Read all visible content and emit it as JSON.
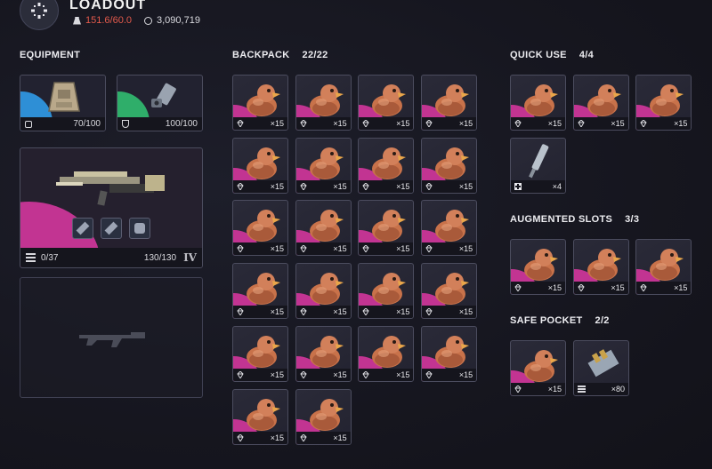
{
  "header": {
    "title": "LOADOUT",
    "weight": "151.6/60.0",
    "currency": "3,090,719"
  },
  "colors": {
    "epic": "#c23492",
    "legendary_blue": "#2e8fd6",
    "uncommon_green": "#2fae6a",
    "weight_over": "#e45a4c"
  },
  "equipment": {
    "label": "EQUIPMENT",
    "augment": {
      "icon": "chest-rig-icon",
      "value": "70/100"
    },
    "shield": {
      "icon": "shield-device-icon",
      "value": "100/100"
    },
    "weapon": {
      "ammo": "0/37",
      "durability": "130/130",
      "tier": "IV"
    }
  },
  "backpack": {
    "label": "BACKPACK",
    "count": "22/22",
    "items": [
      {
        "qty": "×15"
      },
      {
        "qty": "×15"
      },
      {
        "qty": "×15"
      },
      {
        "qty": "×15"
      },
      {
        "qty": "×15"
      },
      {
        "qty": "×15"
      },
      {
        "qty": "×15"
      },
      {
        "qty": "×15"
      },
      {
        "qty": "×15"
      },
      {
        "qty": "×15"
      },
      {
        "qty": "×15"
      },
      {
        "qty": "×15"
      },
      {
        "qty": "×15"
      },
      {
        "qty": "×15"
      },
      {
        "qty": "×15"
      },
      {
        "qty": "×15"
      },
      {
        "qty": "×15"
      },
      {
        "qty": "×15"
      },
      {
        "qty": "×15"
      },
      {
        "qty": "×15"
      },
      {
        "qty": "×15"
      },
      {
        "qty": "×15"
      }
    ]
  },
  "quick_use": {
    "label": "QUICK USE",
    "count": "4/4",
    "items": [
      {
        "qty": "×15"
      },
      {
        "qty": "×15"
      },
      {
        "qty": "×15"
      },
      {
        "qty": "×4"
      }
    ]
  },
  "augmented": {
    "label": "AUGMENTED SLOTS",
    "count": "3/3",
    "items": [
      {
        "qty": "×15"
      },
      {
        "qty": "×15"
      },
      {
        "qty": "×15"
      }
    ]
  },
  "safe_pocket": {
    "label": "SAFE POCKET",
    "count": "2/2",
    "items": [
      {
        "qty": "×15"
      },
      {
        "qty": "×80"
      }
    ]
  }
}
